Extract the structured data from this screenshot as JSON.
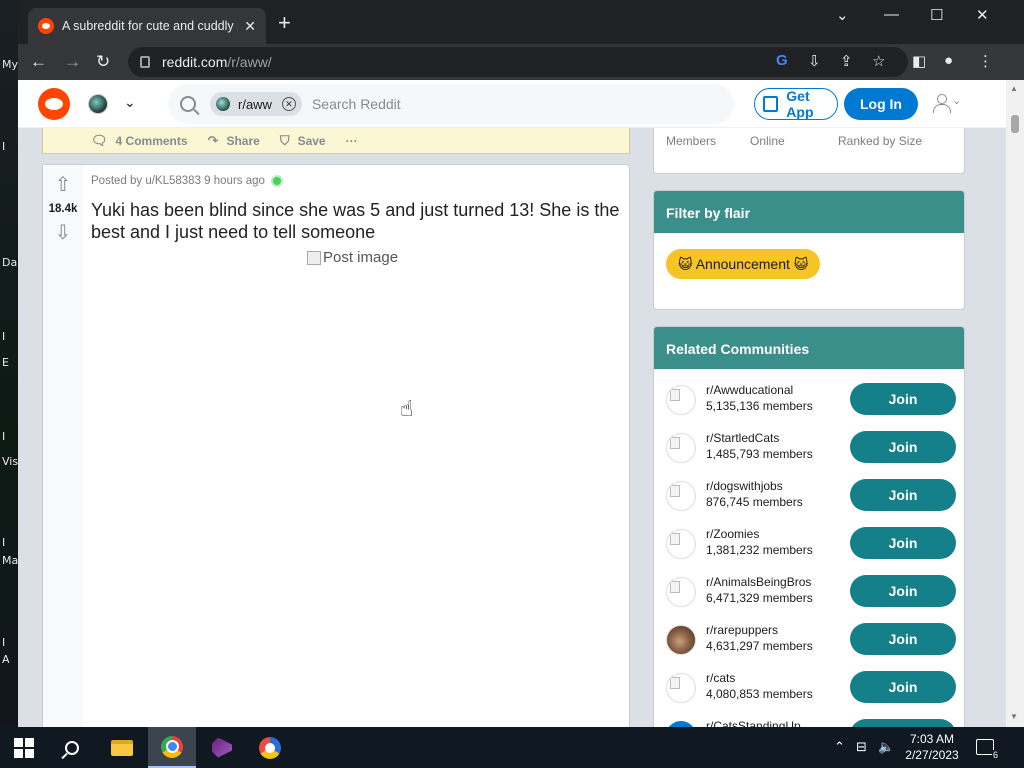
{
  "desktop": {
    "icon_labels": [
      "My",
      "I",
      "Da",
      "I",
      "E",
      "I",
      "Vis",
      "I",
      "Ma",
      "I",
      "A"
    ]
  },
  "browser": {
    "tab_title": "A subreddit for cute and cuddly p",
    "url_domain": "reddit.com",
    "url_path": "/r/aww/"
  },
  "reddit": {
    "subreddit_chip": "r/aww",
    "search_placeholder": "Search Reddit",
    "get_app_label": "Get App",
    "login_label": "Log In"
  },
  "prev_post_actions": {
    "comments": "4 Comments",
    "share": "Share",
    "save": "Save",
    "more": "···"
  },
  "post": {
    "score": "18.4k",
    "meta": "Posted by u/KL58383 9 hours ago",
    "title": "Yuki has been blind since she was 5 and just turned 13! She is the best and I just need to tell someone",
    "image_alt": "Post image"
  },
  "sidebar": {
    "stats_labels": [
      "Members",
      "Online",
      "Ranked by Size"
    ],
    "filter_title": "Filter by flair",
    "flair_label": "😺 Announcement 😺",
    "related_title": "Related Communities",
    "join_label": "Join",
    "communities": [
      {
        "name": "r/Awwducational",
        "members": "5,135,136 members"
      },
      {
        "name": "r/StartledCats",
        "members": "1,485,793 members"
      },
      {
        "name": "r/dogswithjobs",
        "members": "876,745 members"
      },
      {
        "name": "r/Zoomies",
        "members": "1,381,232 members"
      },
      {
        "name": "r/AnimalsBeingBros",
        "members": "6,471,329 members"
      },
      {
        "name": "r/rarepuppers",
        "members": "4,631,297 members"
      },
      {
        "name": "r/cats",
        "members": "4,080,853 members"
      },
      {
        "name": "r/CatsStandingUp",
        "members": ""
      }
    ]
  },
  "taskbar": {
    "time": "7:03 AM",
    "date": "2/27/2023",
    "notifications": "6"
  }
}
